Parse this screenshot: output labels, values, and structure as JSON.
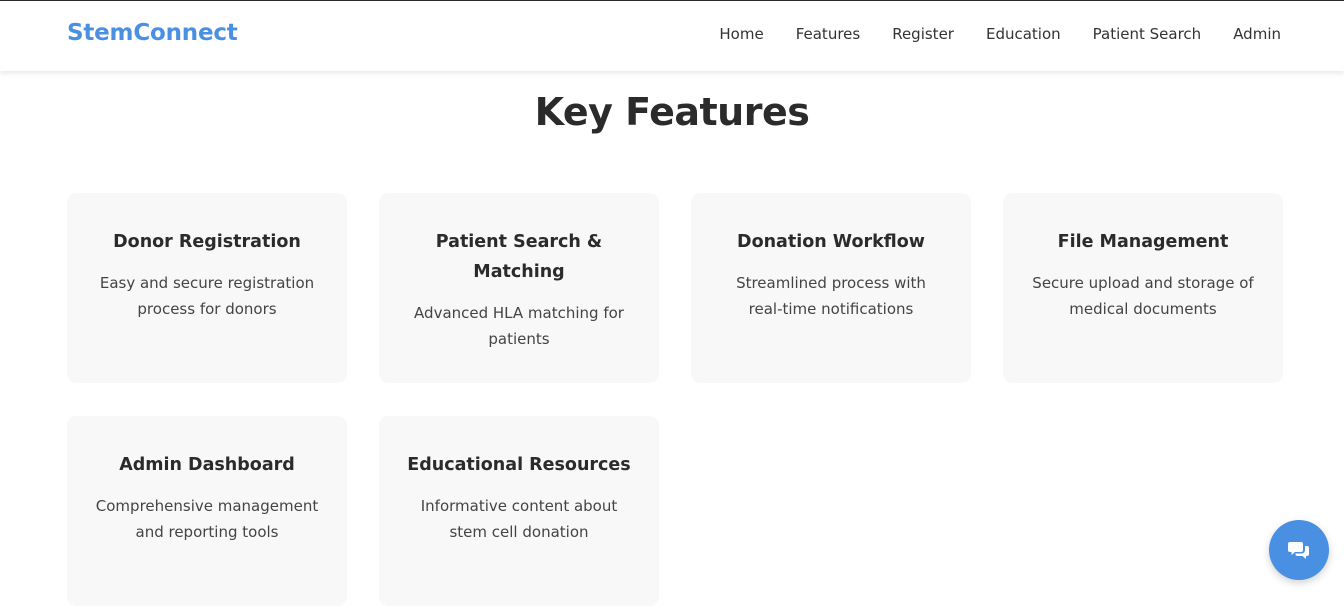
{
  "header": {
    "brand": "StemConnect",
    "nav": [
      {
        "label": "Home"
      },
      {
        "label": "Features"
      },
      {
        "label": "Register"
      },
      {
        "label": "Education"
      },
      {
        "label": "Patient Search"
      },
      {
        "label": "Admin"
      }
    ]
  },
  "features": {
    "title": "Key Features",
    "cards": [
      {
        "title": "Donor Registration",
        "description": "Easy and secure registration process for donors"
      },
      {
        "title": "Patient Search & Matching",
        "description": "Advanced HLA matching for patients"
      },
      {
        "title": "Donation Workflow",
        "description": "Streamlined process with real-time notifications"
      },
      {
        "title": "File Management",
        "description": "Secure upload and storage of medical documents"
      },
      {
        "title": "Admin Dashboard",
        "description": "Comprehensive management and reporting tools"
      },
      {
        "title": "Educational Resources",
        "description": "Informative content about stem cell donation"
      }
    ]
  },
  "chat": {
    "icon": "chat-bubbles-icon"
  },
  "colors": {
    "brand": "#4a90e2",
    "card_bg": "#f8f8f8",
    "heading": "#2b2b2b"
  }
}
